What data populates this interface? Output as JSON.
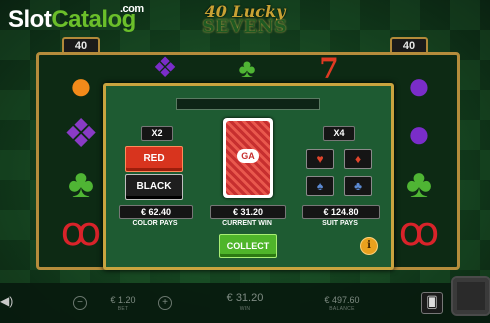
{
  "site": {
    "brand_part1": "Slot",
    "brand_part2": "Catalog",
    "brand_tld": ".com"
  },
  "game": {
    "logo_top": "40 Lucky",
    "logo_bottom": "SEVENS",
    "lines_left": "40",
    "lines_right": "40"
  },
  "reels": {
    "col1": [
      "orange-icon",
      "grapes-icon",
      "clover-icon",
      "cherry-icon"
    ],
    "col2": [
      "plum-icon"
    ],
    "col3": [
      "clover-icon"
    ],
    "col4": [
      "seven-icon"
    ],
    "col5": [
      "plum-icon",
      "plum-icon",
      "clover-icon",
      "cherry-icon"
    ]
  },
  "gamble": {
    "color_multiplier": "X2",
    "suit_multiplier": "X4",
    "red_label": "RED",
    "black_label": "BLACK",
    "card_logo": "GA",
    "color_pays_value": "€ 62.40",
    "color_pays_label": "COLOR PAYS",
    "current_win_value": "€ 31.20",
    "current_win_label": "CURRENT WIN",
    "suit_pays_value": "€ 124.80",
    "suit_pays_label": "SUIT PAYS",
    "collect_label": "COLLECT",
    "info_label": "i",
    "suits": [
      "hearts-icon",
      "diamonds-icon",
      "spades-icon",
      "clubs-icon"
    ]
  },
  "bottom": {
    "bet_value": "€ 1.20",
    "bet_label": "BET",
    "win_value": "€ 31.20",
    "win_label": "WIN",
    "balance_value": "€ 497.60",
    "balance_label": "BALANCE",
    "minus": "−",
    "plus": "+"
  },
  "colors": {
    "accent_gold": "#c9a43f",
    "table_green": "#1e5b32",
    "red_button": "#d8341e",
    "collect_green": "#4fb52a"
  }
}
